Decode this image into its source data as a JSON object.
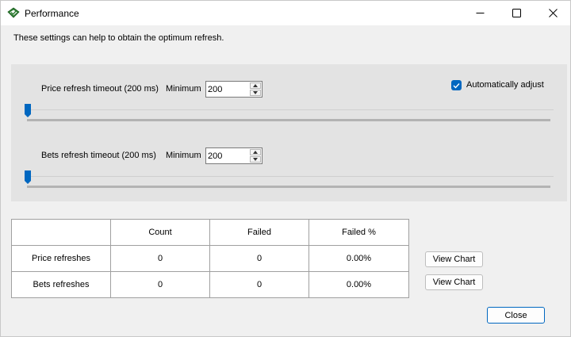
{
  "window": {
    "title": "Performance",
    "intro": "These settings can help to obtain the optimum refresh."
  },
  "settings": {
    "price": {
      "label": "Price refresh timeout (200 ms)",
      "min_label": "Minimum",
      "value": "200",
      "slider_fraction": 0
    },
    "bets": {
      "label": "Bets refresh timeout (200 ms)",
      "min_label": "Minimum",
      "value": "200",
      "slider_fraction": 0
    },
    "auto_adjust": {
      "label": "Automatically adjust",
      "checked": true
    }
  },
  "table": {
    "headers": [
      "",
      "Count",
      "Failed",
      "Failed %"
    ],
    "rows": [
      {
        "name": "Price refreshes",
        "count": "0",
        "failed": "0",
        "failed_pct": "0.00%",
        "action": "View Chart"
      },
      {
        "name": "Bets refreshes",
        "count": "0",
        "failed": "0",
        "failed_pct": "0.00%",
        "action": "View Chart"
      }
    ]
  },
  "buttons": {
    "close": "Close"
  },
  "colors": {
    "accent": "#0067c0",
    "panel": "#e3e3e3",
    "window": "#f0f0f0"
  },
  "icons": {
    "app": "diamond-logo-icon",
    "minimize": "minimize-icon",
    "maximize": "maximize-icon",
    "close": "close-icon"
  }
}
